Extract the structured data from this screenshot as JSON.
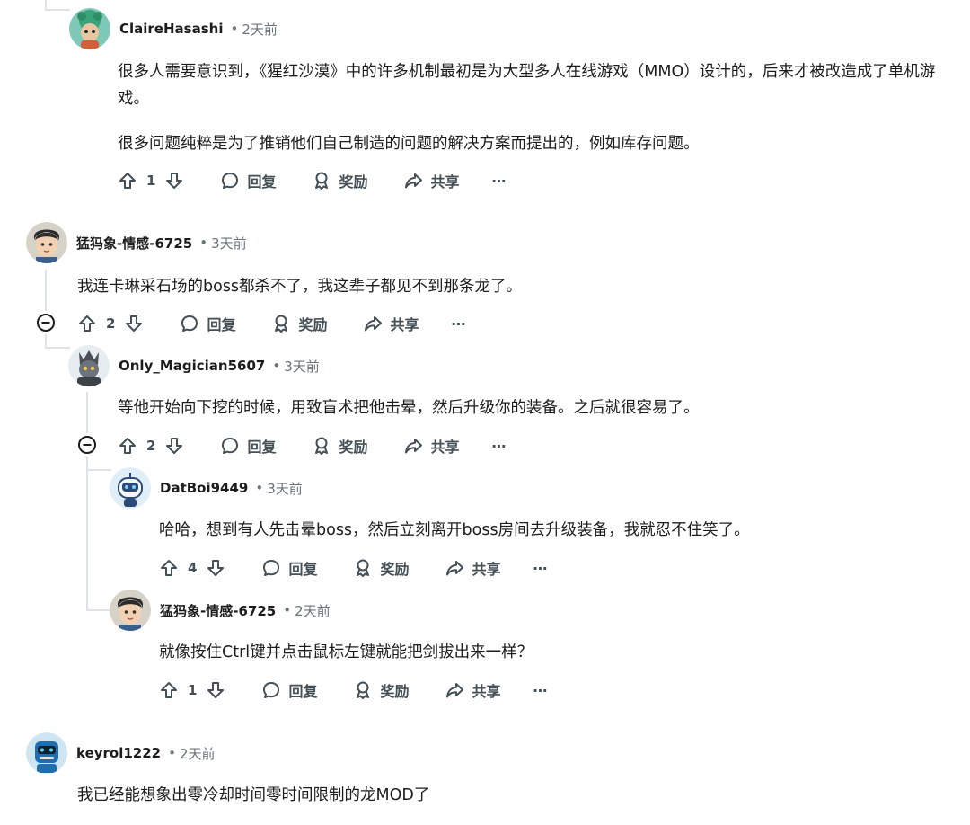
{
  "time_separator": "•",
  "labels": {
    "reply": "回复",
    "award": "奖励",
    "share": "共享",
    "more": "⋯"
  },
  "comments": [
    {
      "user": "ClaireHasashi",
      "time": "2天前",
      "paragraphs": [
        "很多人需要意识到，《猩红沙漠》中的许多机制最初是为大型多人在线游戏（MMO）设计的，后来才被改造成了单机游戏。",
        "很多问题纯粹是为了推销他们自己制造的问题的解决方案而提出的，例如库存问题。"
      ],
      "votes": "1"
    },
    {
      "user": "猛犸象-情感-6725",
      "time": "3天前",
      "paragraphs": [
        "我连卡琳采石场的boss都杀不了，我这辈子都见不到那条龙了。"
      ],
      "votes": "2"
    },
    {
      "user": "Only_Magician5607",
      "time": "3天前",
      "paragraphs": [
        "等他开始向下挖的时候，用致盲术把他击晕，然后升级你的装备。之后就很容易了。"
      ],
      "votes": "2"
    },
    {
      "user": "DatBoi9449",
      "time": "3天前",
      "paragraphs": [
        "哈哈，想到有人先击晕boss，然后立刻离开boss房间去升级装备，我就忍不住笑了。"
      ],
      "votes": "4"
    },
    {
      "user": "猛犸象-情感-6725",
      "time": "2天前",
      "paragraphs": [
        "就像按住Ctrl键并点击鼠标左键就能把剑拔出来一样？"
      ],
      "votes": "1"
    },
    {
      "user": "keyrol1222",
      "time": "2天前",
      "paragraphs": [
        "我已经能想象出零冷却时间零时间限制的龙MOD了"
      ],
      "votes": ""
    }
  ],
  "colors": {
    "text": "#1c1c1c",
    "muted": "#6b7479",
    "action": "#454f56",
    "thread_line": "#dfe3e6"
  }
}
